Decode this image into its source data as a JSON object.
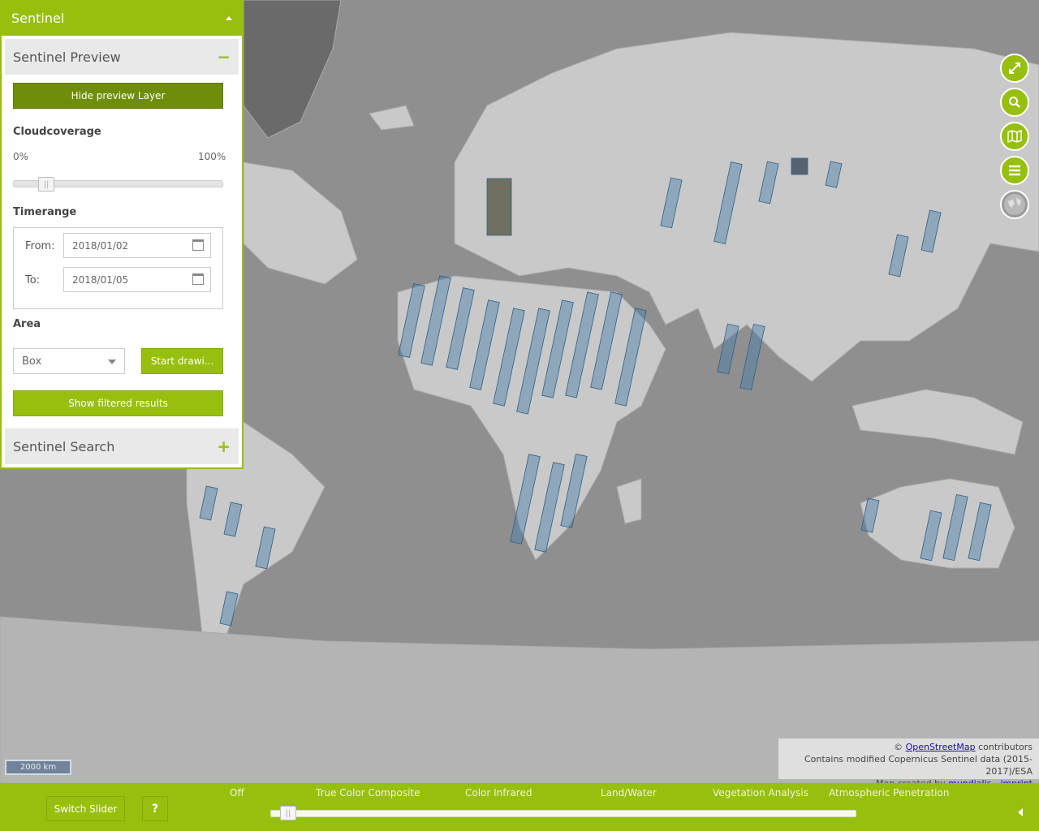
{
  "panel": {
    "title": "Sentinel",
    "preview": {
      "title": "Sentinel Preview",
      "hide_button": "Hide preview Layer",
      "cloud_label": "Cloudcoverage",
      "cloud_min": "0%",
      "cloud_max": "100%",
      "cloud_value_pct": 13,
      "time_label": "Timerange",
      "from_label": "From:",
      "from_value": "2018/01/02",
      "to_label": "To:",
      "to_value": "2018/01/05",
      "area_label": "Area",
      "area_select": "Box",
      "draw_button": "Start drawi...",
      "filter_button": "Show filtered results"
    },
    "search": {
      "title": "Sentinel Search"
    }
  },
  "map_controls": [
    "fullscreen-icon",
    "search-icon",
    "map-icon",
    "layers-menu-icon",
    "globe-icon"
  ],
  "attribution": {
    "copy": "©",
    "osm_link": "OpenStreetMap",
    "osm_suffix": "contributors",
    "line2": "Contains modified Copernicus Sentinel data (2015-2017)/ESA",
    "line3_prefix": "Map created by",
    "mundialis_link": "mundialis",
    "sep": "-",
    "imprint_link": "imprint"
  },
  "scale": "2000 km",
  "bottom": {
    "switch_button": "Switch Slider",
    "help_button": "?",
    "labels": [
      "Off",
      "True Color Composite",
      "Color Infrared",
      "Land/Water",
      "Vegetation Analysis",
      "Atmospheric Penetration"
    ]
  },
  "colors": {
    "accent": "#97bf0d",
    "accent_dark": "#6f8d08",
    "footprint": "#4a7fa8"
  }
}
